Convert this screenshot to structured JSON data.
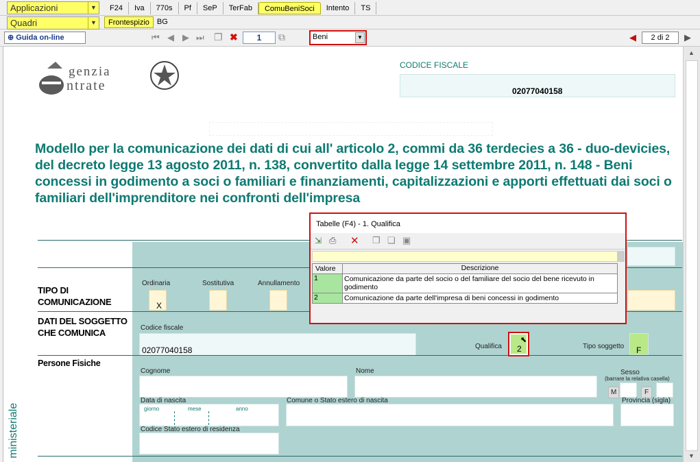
{
  "top": {
    "applicazioni_label": "Applicazioni",
    "quadri_label": "Quadri",
    "tabs": [
      "F24",
      "Iva",
      "770s",
      "Pf",
      "SeP",
      "TerFab",
      "ComuBeniSoci",
      "Intento",
      "TS"
    ],
    "active_tab": "ComuBeniSoci",
    "subtabs": [
      "Frontespizio",
      "BG"
    ],
    "active_subtab": "Frontespizio"
  },
  "toolbar": {
    "guida_label": "Guida on-line",
    "page_number": "1",
    "section_select": "Beni",
    "page_indicator": "2 di 2"
  },
  "doc": {
    "logo_text_1": "genzia",
    "logo_text_2": "ntrate",
    "cf_header": "CODICE FISCALE",
    "cf_value": "02077040158",
    "title": "Modello per la comunicazione dei dati di cui all' articolo 2, commi da 36 terdecies a 36 - duo-devicies, del decreto legge 13 agosto 2011, n. 138, convertito dalla legge 14 settembre 2011, n. 148 - Beni concessi in godimento a soci o familiari e finanziamenti, capitalizzazioni e apporti effettuati dai soci o familiari dell'imprenditore nei confronti dell'impresa",
    "tipo_label": "TIPO DI\nCOMUNICAZIONE",
    "ordinaria": "Ordinaria",
    "sostitutiva": "Sostitutiva",
    "annullamento": "Annullamento",
    "ordinaria_mark": "X",
    "dati_label": "DATI DEL SOGGETTO\nCHE COMUNICA",
    "codice_fiscale_label": "Codice fiscale",
    "codice_fiscale_value": "02077040158",
    "qualifica_label": "Qualifica",
    "qualifica_value": "2",
    "tipo_soggetto_label": "Tipo soggetto",
    "tipo_soggetto_value": "F",
    "persone_fisiche": "Persone Fisiche",
    "cognome": "Cognome",
    "nome": "Nome",
    "sesso": "Sesso",
    "sesso_note": "(barrare la relativa casella)",
    "m": "M",
    "f": "F",
    "data_nascita": "Data di nascita",
    "giorno": "giorno",
    "mese": "mese",
    "anno": "anno",
    "comune": "Comune o Stato estero di nascita",
    "provincia": "Provincia (sigla)",
    "codice_stato": "Codice Stato estero di residenza",
    "side_label": "o ministeriale"
  },
  "popup": {
    "title": "Tabelle (F4) - 1. Qualifica",
    "col_valore": "Valore",
    "col_descrizione": "Descrizione",
    "rows": [
      {
        "valore": "1",
        "descrizione": "Comunicazione da parte del socio o del familiare del socio del bene ricevuto in godimento"
      },
      {
        "valore": "2",
        "descrizione": "Comunicazione da parte dell'impresa di beni concessi in godimento"
      }
    ]
  }
}
